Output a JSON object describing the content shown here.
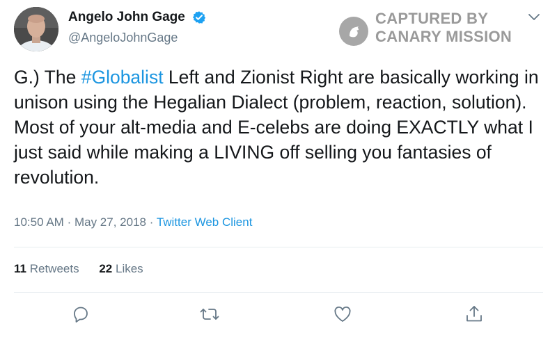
{
  "author": {
    "name": "Angelo John Gage",
    "handle": "@AngeloJohnGage",
    "avatar_icon": "profile-photo",
    "verified_icon": "verified-badge-icon"
  },
  "watermark": {
    "line1": "CAPTURED BY",
    "line2": "CANARY MISSION",
    "logo_icon": "canary-logo-icon"
  },
  "tweet": {
    "prefix": "G.) The ",
    "hashtag": "#Globalist",
    "rest": " Left and Zionist Right are basically working in unison using the Hegalian Dialect (problem, reaction, solution). Most of your alt-media and E-celebs are doing EXACTLY what I just said while making a LIVING off selling you fantasies of revolution."
  },
  "meta": {
    "time": "10:50 AM",
    "separator": "·",
    "date": "May 27, 2018",
    "client": "Twitter Web Client"
  },
  "stats": {
    "retweets_count": "11",
    "retweets_label": "Retweets",
    "likes_count": "22",
    "likes_label": "Likes"
  },
  "actions": {
    "reply_icon": "reply-icon",
    "retweet_icon": "retweet-icon",
    "like_icon": "heart-icon",
    "share_icon": "share-icon"
  },
  "colors": {
    "accent": "#1b95e0",
    "secondary_text": "#657786",
    "watermark": "#9a9a9a"
  }
}
